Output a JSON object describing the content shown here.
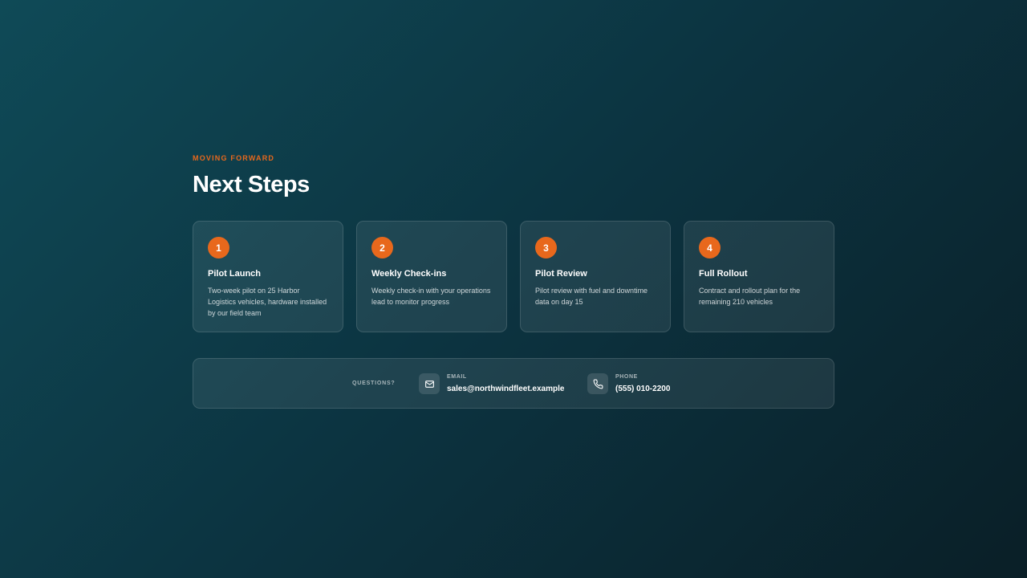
{
  "header": {
    "eyebrow": "MOVING FORWARD",
    "title": "Next Steps"
  },
  "steps": [
    {
      "number": "1",
      "title": "Pilot Launch",
      "description": "Two-week pilot on 25 Harbor Logistics vehicles, hardware installed by our field team"
    },
    {
      "number": "2",
      "title": "Weekly Check-ins",
      "description": "Weekly check-in with your operations lead to monitor progress"
    },
    {
      "number": "3",
      "title": "Pilot Review",
      "description": "Pilot review with fuel and downtime data on day 15"
    },
    {
      "number": "4",
      "title": "Full Rollout",
      "description": "Contract and rollout plan for the remaining 210 vehicles"
    }
  ],
  "contact": {
    "label": "QUESTIONS?",
    "email": {
      "icon": "mail-icon",
      "label": "EMAIL",
      "value": "sales@northwindfleet.example"
    },
    "phone": {
      "icon": "phone-icon",
      "label": "PHONE",
      "value": "(555) 010-2200"
    }
  },
  "colors": {
    "accent": "#e8681c",
    "background_start": "#0f4a57",
    "background_end": "#0a1f27"
  }
}
